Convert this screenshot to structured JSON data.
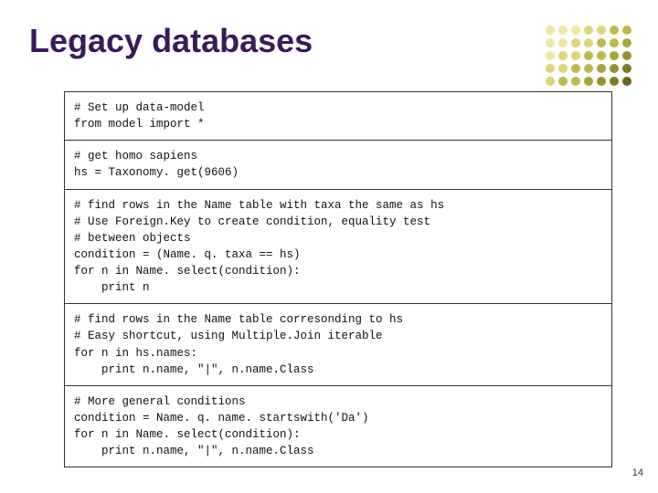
{
  "title": "Legacy databases",
  "page_number": "14",
  "deco_colors": [
    "#efe6a2",
    "#efe6a2",
    "#efe6a2",
    "#ded47a",
    "#ded47a",
    "#bfb84a",
    "#bfb84a",
    "#efe6a2",
    "#efe6a2",
    "#ded47a",
    "#ded47a",
    "#bfb84a",
    "#bfb84a",
    "#a9a43a",
    "#efe6a2",
    "#ded47a",
    "#ded47a",
    "#bfb84a",
    "#bfb84a",
    "#a9a43a",
    "#97922f",
    "#ded47a",
    "#ded47a",
    "#bfb84a",
    "#bfb84a",
    "#a9a43a",
    "#97922f",
    "#7d7a25",
    "#ded47a",
    "#bfb84a",
    "#bfb84a",
    "#a9a43a",
    "#97922f",
    "#7d7a25",
    "#6b681e"
  ],
  "code_blocks": [
    "# Set up data-model\nfrom model import *",
    "# get homo sapiens\nhs = Taxonomy. get(9606)",
    "# find rows in the Name table with taxa the same as hs\n# Use Foreign.Key to create condition, equality test\n# between objects\ncondition = (Name. q. taxa == hs)\nfor n in Name. select(condition):\n    print n",
    "# find rows in the Name table corresonding to hs\n# Easy shortcut, using Multiple.Join iterable\nfor n in hs.names:\n    print n.name, \"|\", n.name.Class",
    "# More general conditions\ncondition = Name. q. name. startswith('Da')\nfor n in Name. select(condition):\n    print n.name, \"|\", n.name.Class"
  ]
}
